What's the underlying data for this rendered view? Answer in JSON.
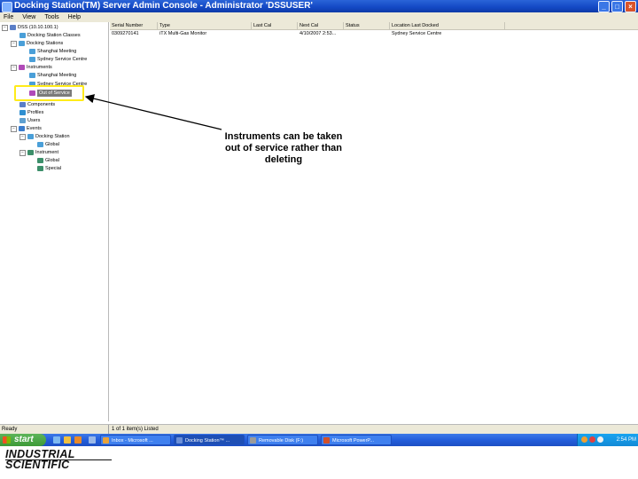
{
  "window": {
    "title": "Docking Station(TM) Server Admin Console - Administrator 'DSSUSER'"
  },
  "menu": [
    "File",
    "View",
    "Tools",
    "Help"
  ],
  "tree": {
    "root": "DSS (10.10.100.1)",
    "docking_station_classes": "Docking Station Classes",
    "docking_stations": "Docking Stations",
    "ds_shanghai": "Shanghai Meeting",
    "ds_sydney": "Sydney Service Centre",
    "instruments": "Instruments",
    "inst_shanghai": "Shanghai Meeting",
    "inst_sydney": "Sydney Service Centre",
    "out_of_service": "Out of Service",
    "components": "Components",
    "profiles": "Profiles",
    "users": "Users",
    "events": "Events",
    "ev_docking_station": "Docking Station",
    "ev_ds_global": "Global",
    "ev_instrument": "Instrument",
    "ev_inst_global": "Global",
    "ev_inst_special": "Special"
  },
  "list": {
    "columns": [
      "Serial Number",
      "Type",
      "Last Cal",
      "Next Cal",
      "Status",
      "Location Last Docked"
    ],
    "rows": [
      [
        "0309270141",
        "iTX Multi-Gas Monitor",
        "",
        "4/10/2007 2:53...",
        "",
        "Sydney Service Centre"
      ]
    ]
  },
  "callout": {
    "text": "Instruments can be taken out of service rather than deleting"
  },
  "status": {
    "left": "Ready",
    "right": "1 of 1 item(s) Listed"
  },
  "taskbar": {
    "start_label": "start",
    "apps": [
      {
        "label": "Inbox - Microsoft ...",
        "color": "#e8a23a"
      },
      {
        "label": "Docking Station™ ...",
        "color": "#6b8fd8"
      },
      {
        "label": "Removable Disk (F:)",
        "color": "#9b9b9b"
      },
      {
        "label": "Microsoft PowerP...",
        "color": "#d0502a"
      }
    ],
    "clock": "2:54 PM"
  },
  "branding": {
    "line1": "INDUSTRIAL",
    "line2": "SCIENTIFIC"
  },
  "colors": {
    "title_blue": "#1348c4",
    "highlight_yellow": "#ffeb1a",
    "start_green": "#3c9a37"
  }
}
